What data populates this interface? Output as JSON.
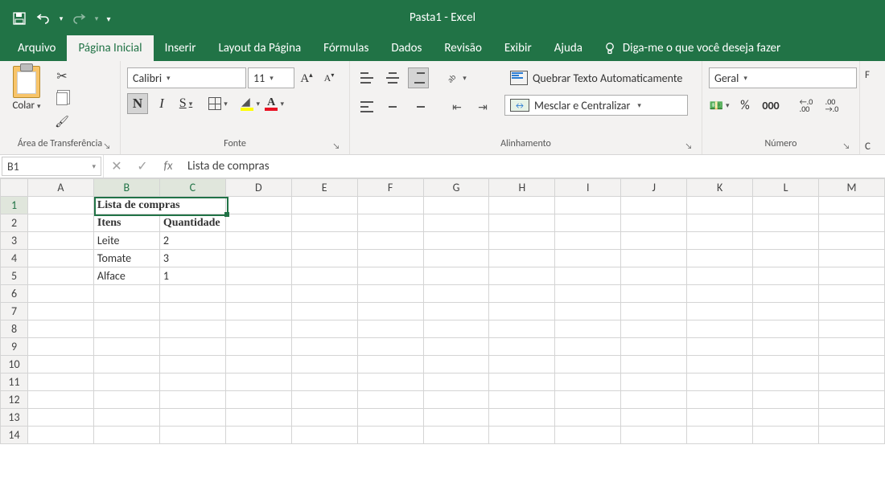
{
  "app": {
    "title": "Pasta1  -  Excel"
  },
  "tabs": {
    "file": "Arquivo",
    "items": [
      "Página Inicial",
      "Inserir",
      "Layout da Página",
      "Fórmulas",
      "Dados",
      "Revisão",
      "Exibir",
      "Ajuda"
    ],
    "active_index": 0,
    "tell_me": "Diga-me o que você deseja fazer"
  },
  "ribbon": {
    "clipboard": {
      "paste": "Colar",
      "group_label": "Área de Transferência"
    },
    "font": {
      "name": "Calibri",
      "size": "11",
      "group_label": "Fonte"
    },
    "alignment": {
      "wrap": "Quebrar Texto Automaticamente",
      "merge": "Mesclar e Centralizar",
      "group_label": "Alinhamento"
    },
    "number": {
      "format": "Geral",
      "group_label": "Número",
      "thousand": "000",
      "dec_inc": "◄,0\n,00",
      "dec_dec": ",00\n▸,0"
    },
    "right_cut": {
      "f": "F",
      "c": "C"
    }
  },
  "formula_bar": {
    "name_box": "B1",
    "fx": "fx",
    "formula": "Lista de compras"
  },
  "sheet": {
    "columns": [
      "A",
      "B",
      "C",
      "D",
      "E",
      "F",
      "G",
      "H",
      "I",
      "J",
      "K",
      "L",
      "M"
    ],
    "rows": 14,
    "selection": {
      "ref": "B1:C1"
    },
    "cells": {
      "B1": {
        "v": "Lista de compras",
        "merge_to": "C1",
        "bold": true,
        "center": true
      },
      "B2": {
        "v": "Itens",
        "bold": true,
        "center": true
      },
      "C2": {
        "v": "Quantidade",
        "bold": true,
        "center": true
      },
      "B3": {
        "v": "Leite"
      },
      "C3": {
        "v": "2",
        "num": true
      },
      "B4": {
        "v": "Tomate"
      },
      "C4": {
        "v": "3",
        "num": true
      },
      "B5": {
        "v": "Alface"
      },
      "C5": {
        "v": "1",
        "num": true
      }
    }
  },
  "chart_data": {
    "type": "table",
    "title": "Lista de compras",
    "columns": [
      "Itens",
      "Quantidade"
    ],
    "rows": [
      [
        "Leite",
        2
      ],
      [
        "Tomate",
        3
      ],
      [
        "Alface",
        1
      ]
    ]
  }
}
